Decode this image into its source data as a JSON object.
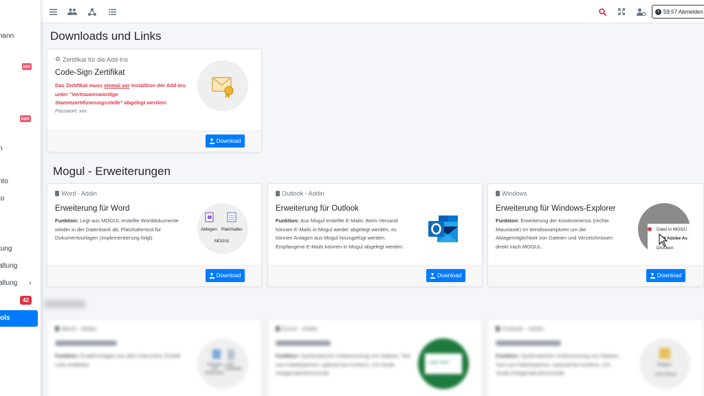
{
  "sidebar": {
    "items": [
      {
        "label": "hann"
      },
      {
        "label": ""
      },
      {
        "label": ""
      },
      {
        "label": "n"
      },
      {
        "label": "nto"
      },
      {
        "label": "to"
      },
      {
        "label": "tung"
      },
      {
        "label": "altung"
      },
      {
        "label": "altung"
      },
      {
        "label": "ols"
      }
    ],
    "badge": "42"
  },
  "topbar": {
    "timer_label": "59:57 Abmelden"
  },
  "downloads": {
    "heading": "Downloads und Links",
    "cert_card": {
      "header": "Zertifikat für die Add-Ins",
      "title": "Code-Sign Zertifikat",
      "warn_part1": "Das Zertifikat muss ",
      "warn_em": "einmal vor",
      "warn_part2": " Installtion der Add-Ins unter ",
      "warn_quote": "\"Vertrauenswürdige Stammzertifizierungsstelle\"",
      "warn_part3": " abgelegt werden!",
      "password": "Passwort: xxx",
      "button": "Download"
    }
  },
  "mogul": {
    "heading": "Mogul - Erweiterungen",
    "cards": [
      {
        "header": "Word - Addin",
        "title": "Erweiterung für Word",
        "label": "Funktion:",
        "text": "Legt aus MOGUL erstellte Worddokumente wieder in der Datenbank ab, Platzhaltertool für Dokumentvorlagen (implementierung folgt)",
        "icon_left": "Ablegen",
        "icon_right": "Platzhalter",
        "icon_group": "MOGUL",
        "button": "Download"
      },
      {
        "header": "Outlook - Addin",
        "title": "Erweiterung für Outlook",
        "label": "Funktion:",
        "text": "Aus Mogul erstellte E-Mails: Beim Versand können E-Mails in Mogul wieder abgelegt werden, es können Anlagen aus Mogul hinzugefügt werden. Empfangene E-Mails können in Mogul abgelegt werden.",
        "button": "Download"
      },
      {
        "header": "Windows",
        "title": "Erweiterung für Windows-Explorer",
        "label": "Funktion:",
        "text": "Erweiterung der Kontextmenüs (rechte Maustaste) im Windowsexplorer um die Ablagemöglichkeit von Dateien und Verzeichnissen direkt nach MOGUL.",
        "menu_item1": "Datei in MOGU",
        "menu_item2": "M Adobe Ac",
        "menu_item3": "Drucken",
        "button": "Download"
      }
    ]
  },
  "blurred": {
    "cards": [
      {
        "header": "Word - Addin",
        "label": "Funktion:",
        "text": "Erstellt Anlagen aus dem Dokument, Erstellt Leitz-Aufkleber",
        "icon_a": "Anlagen aus Dokument",
        "icon_b": "Leitz-Aufkleber"
      },
      {
        "header": "Excel - Addin",
        "label": "Funktion:",
        "text": "Systematische Umbenennung von Dateien, Tool zum Dateikopieren, optional bei Konform, CA-Vorab-Anlagenabnahmemode.",
        "icon_a": "Leitz-Tools"
      },
      {
        "header": "Outlook - Addin",
        "label": "Funktion:",
        "text": "Systematische Umbenennung von Dateien, Tool zum Dateikopieren, optional bei Konform, CA-Vorab-Anlagenabnahmemode.",
        "icon_a": "Ablagen",
        "icon_b": "(AA) Pause"
      }
    ]
  },
  "colors": {
    "primary": "#007bff",
    "danger": "#dc3545",
    "warning_text": "#dc3545"
  }
}
